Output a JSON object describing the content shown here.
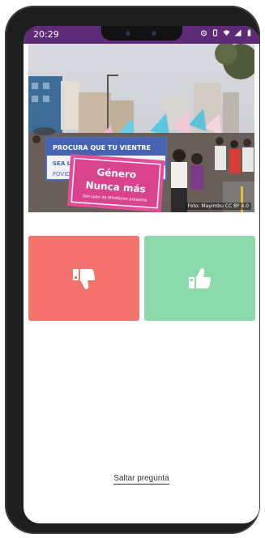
{
  "status_bar": {
    "time": "20:29",
    "background": "#5e2a76",
    "icons": [
      "alarm-icon",
      "vibrate-icon",
      "wifi-icon",
      "signal-icon",
      "battery-icon"
    ]
  },
  "photo": {
    "banner_front": "Género Nunca más",
    "banner_front_sub": "San Juan de Miraflores presente",
    "banner_back": "PROCURA QUE TU VIENTRE SEA UNA CUNA Y NO UN CEMENTERIO",
    "banner_back_short": "FOVIDA",
    "credit": "Foto: Mayimbu CC BY 4.0"
  },
  "vote": {
    "dislike_color": "#f5736f",
    "like_color": "#8cd9ac",
    "dislike_icon": "thumbs-down-icon",
    "like_icon": "thumbs-up-icon"
  },
  "skip_label": "Saltar pregunta"
}
